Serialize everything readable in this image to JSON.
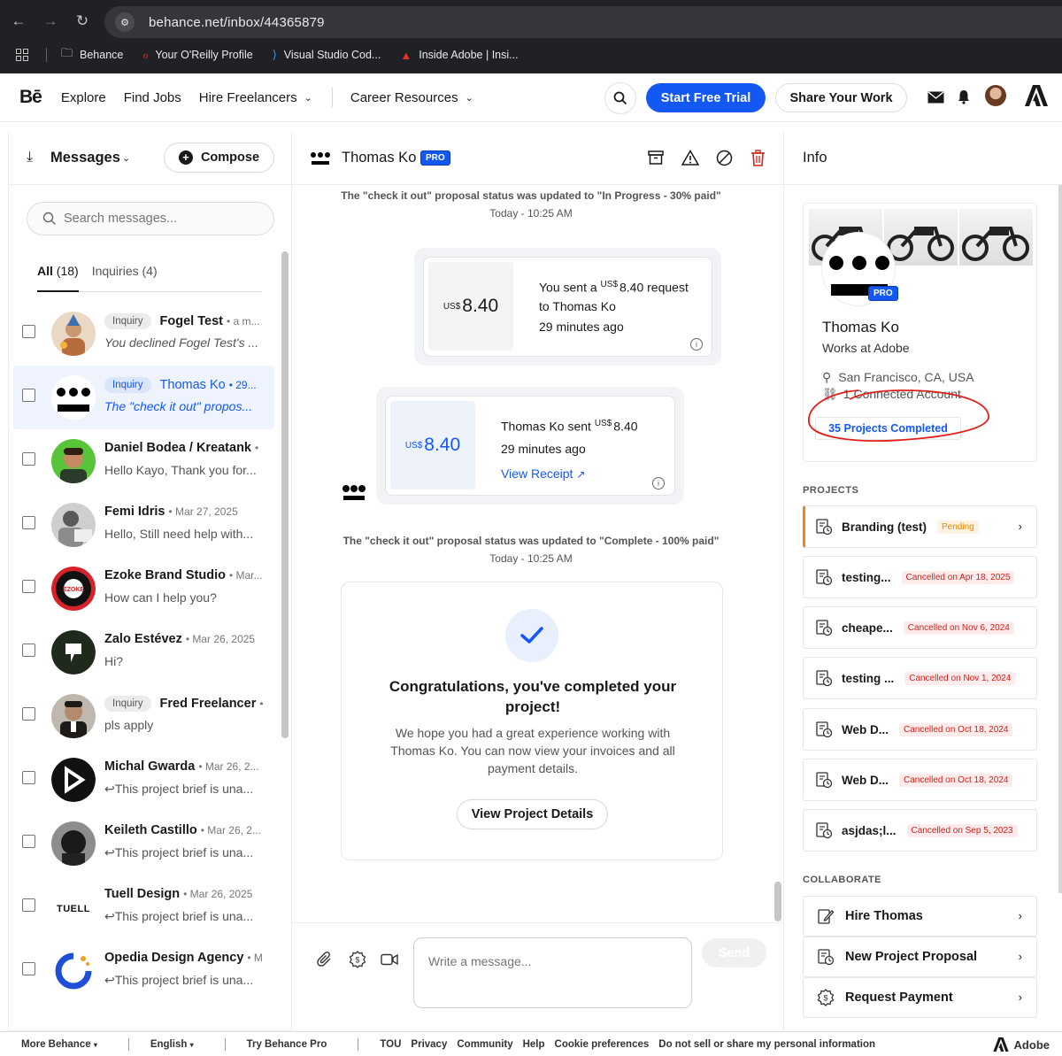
{
  "browser": {
    "url": "behance.net/inbox/44365879",
    "bookmarks": [
      "Behance",
      "Your O'Reilly Profile",
      "Visual Studio Cod...",
      "Inside Adobe | Insi..."
    ]
  },
  "nav": {
    "logo": "Bē",
    "explore": "Explore",
    "find_jobs": "Find Jobs",
    "hire": "Hire Freelancers",
    "career": "Career Resources",
    "trial": "Start Free Trial",
    "share": "Share Your Work"
  },
  "messages": {
    "title": "Messages",
    "compose": "Compose",
    "search_placeholder": "Search messages...",
    "tab_all_label": "All",
    "tab_all_count": "(18)",
    "tab_inquiries": "Inquiries (4)",
    "items": [
      {
        "badge": "Inquiry",
        "name": "Fogel Test",
        "date": "• a m...",
        "preview": "You declined Fogel Test's ..."
      },
      {
        "badge": "Inquiry",
        "name": "Thomas Ko",
        "date": "• 29...",
        "preview": "The \"check it out\" propos..."
      },
      {
        "badge": "",
        "name": "Daniel Bodea / Kreatank",
        "date": "•",
        "preview": "Hello Kayo, Thank you for..."
      },
      {
        "badge": "",
        "name": "Femi Idris",
        "date": "• Mar 27, 2025",
        "preview": "Hello, Still need help with..."
      },
      {
        "badge": "",
        "name": "Ezoke Brand Studio",
        "date": "• Mar...",
        "preview": "How can I help you?"
      },
      {
        "badge": "",
        "name": "Zalo Estévez",
        "date": "• Mar 26, 2025",
        "preview": "Hi?"
      },
      {
        "badge": "Inquiry",
        "name": "Fred Freelancer",
        "date": "•",
        "preview": "pls apply"
      },
      {
        "badge": "",
        "name": "Michal Gwarda",
        "date": "• Mar 26, 2...",
        "preview": "This project brief is una..."
      },
      {
        "badge": "",
        "name": "Keileth Castillo",
        "date": "• Mar 26, 2...",
        "preview": "This project brief is una..."
      },
      {
        "badge": "",
        "name": "Tuell Design",
        "date": "• Mar 26, 2025",
        "preview": "This project brief is una..."
      },
      {
        "badge": "",
        "name": "Opedia Design Agency",
        "date": "• M",
        "preview": "This project brief is una..."
      }
    ],
    "avatar_texts": {
      "ezoke": "EZOKE",
      "tuell": "TUELL"
    }
  },
  "conversation": {
    "name": "Thomas Ko",
    "pro": "PRO",
    "status1_pre": "The \"check it out\" proposal status was updated to ",
    "status1_val": "\"In Progress - 30% paid\"",
    "status1_time": "Today - 10:25 AM",
    "request_currency": "US$",
    "request_amount": "8.40",
    "request_line1": "You sent a",
    "request_line1_cur": "US$",
    "request_line1_amt": "8.40 request",
    "request_line2": "to Thomas Ko",
    "request_time": "29 minutes ago",
    "sent_currency": "US$",
    "sent_amount": "8.40",
    "sent_line1": "Thomas Ko sent",
    "sent_line1_cur": "US$",
    "sent_line1_amt": "8.40",
    "sent_time": "29 minutes ago",
    "receipt": "View Receipt",
    "status2_pre": "The \"check it out\" proposal status was updated to ",
    "status2_val": "\"Complete - 100% paid\"",
    "status2_time": "Today - 10:25 AM",
    "congrats_title": "Congratulations, you've completed your project!",
    "congrats_body": "We hope you had a great experience working with Thomas Ko. You can now view your invoices and all payment details.",
    "view_details": "View Project Details",
    "composer_placeholder": "Write a message...",
    "send": "Send"
  },
  "info": {
    "title": "Info",
    "pro": "PRO",
    "name": "Thomas Ko",
    "job": "Works at Adobe",
    "location": "San Francisco, CA, USA",
    "connected": "1 Connected Account",
    "completed": "35 Projects Completed",
    "projects_label": "PROJECTS",
    "projects": [
      {
        "title": "Branding (test)",
        "status": "Pending",
        "type": "pending"
      },
      {
        "title": "testing...",
        "status": "Cancelled on Apr 18, 2025",
        "type": "cancel"
      },
      {
        "title": "cheape...",
        "status": "Cancelled on Nov 6, 2024",
        "type": "cancel"
      },
      {
        "title": "testing ...",
        "status": "Cancelled on Nov 1, 2024",
        "type": "cancel"
      },
      {
        "title": "Web D...",
        "status": "Cancelled on Oct 18, 2024",
        "type": "cancel"
      },
      {
        "title": "Web D...",
        "status": "Cancelled on Oct 18, 2024",
        "type": "cancel"
      },
      {
        "title": "asjdas;l...",
        "status": "Cancelled on Sep 5, 2023",
        "type": "cancel"
      }
    ],
    "collaborate_label": "COLLABORATE",
    "collab": [
      "Hire Thomas",
      "New Project Proposal",
      "Request Payment"
    ]
  },
  "footer": {
    "more": "More Behance",
    "lang": "English",
    "pro": "Try Behance Pro",
    "links": [
      "TOU",
      "Privacy",
      "Community",
      "Help",
      "Cookie preferences",
      "Do not sell or share my personal information"
    ],
    "adobe": "Adobe"
  },
  "colors": {
    "accent": "#1358f2",
    "pending": "#e68a00",
    "cancel": "#d1201a",
    "annotation": "#e0201b"
  }
}
